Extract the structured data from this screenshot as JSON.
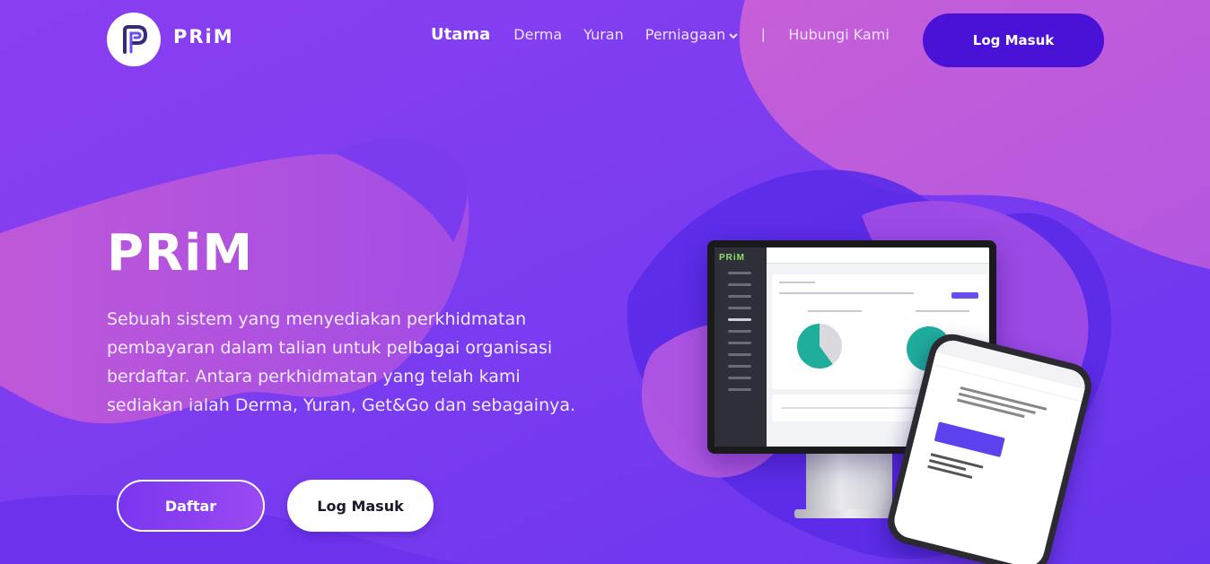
{
  "header": {
    "logo_text": "PRiM",
    "nav": [
      {
        "label": "Utama",
        "active": true
      },
      {
        "label": "Derma"
      },
      {
        "label": "Yuran"
      },
      {
        "label": "Perniagaan",
        "dropdown": true
      },
      {
        "label": "Hubungi Kami"
      }
    ],
    "separator": "|",
    "login_label": "Log Masuk"
  },
  "hero": {
    "title": "PRiM",
    "description": "Sebuah sistem yang menyediakan perkhidmatan pembayaran dalam talian untuk pelbagai organisasi berdaftar. Antara perkhidmatan yang telah kami sediakan ialah Derma, Yuran, Get&Go dan sebagainya.",
    "register_label": "Daftar",
    "login_label": "Log Masuk"
  },
  "colors": {
    "background": "#7a3ff0",
    "accent": "#4a12d6",
    "blob_pink": "#c25ad8",
    "chart_teal": "#1fae9c"
  },
  "icons": {
    "logo": "prim-p-logo",
    "dropdown": "chevron-down-icon"
  }
}
